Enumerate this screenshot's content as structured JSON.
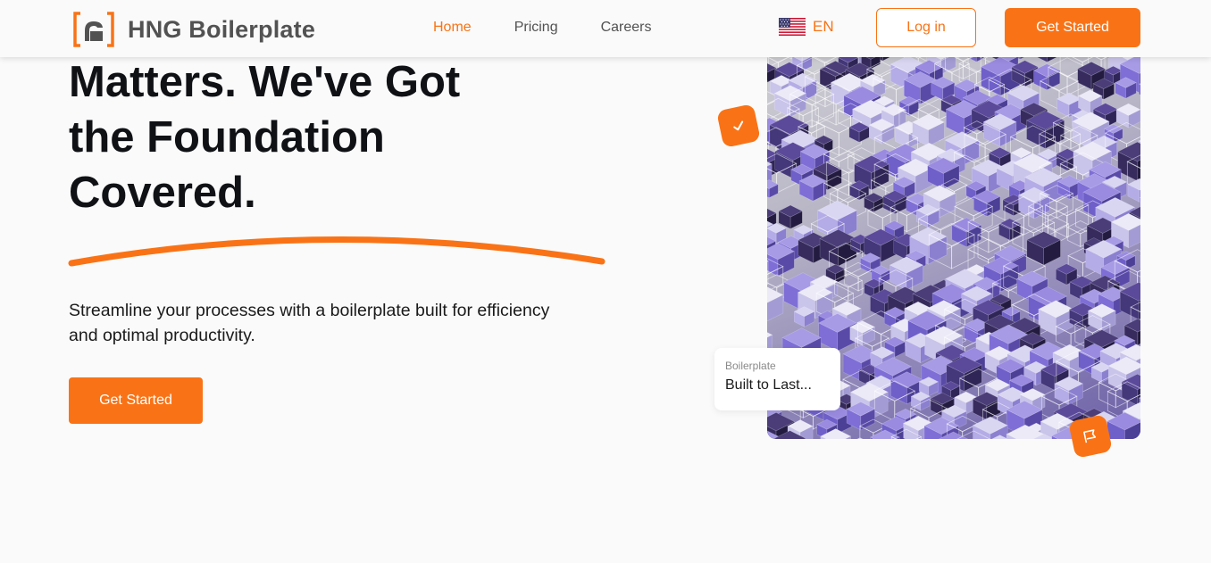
{
  "header": {
    "brand": "HNG Boilerplate",
    "nav": [
      {
        "label": "Home",
        "active": true
      },
      {
        "label": "Pricing",
        "active": false
      },
      {
        "label": "Careers",
        "active": false
      }
    ],
    "language": {
      "label": "EN",
      "flag_icon": "us-flag-icon"
    },
    "login_label": "Log in",
    "cta_label": "Get Started"
  },
  "hero": {
    "title_lines": [
      "Matters. We've Got",
      "the Foundation",
      "Covered."
    ],
    "description_lines": [
      "Streamline your processes with a boilerplate built for efficiency",
      "and optimal productivity."
    ],
    "cta_label": "Get Started"
  },
  "visual": {
    "card_label": "Boilerplate",
    "card_title": "Built to Last...",
    "check_icon": "check-icon",
    "flag_icon": "flag-icon"
  },
  "colors": {
    "accent": "#f97316",
    "background": "#fafafa",
    "text": "#0f1115",
    "muted": "#525252"
  }
}
